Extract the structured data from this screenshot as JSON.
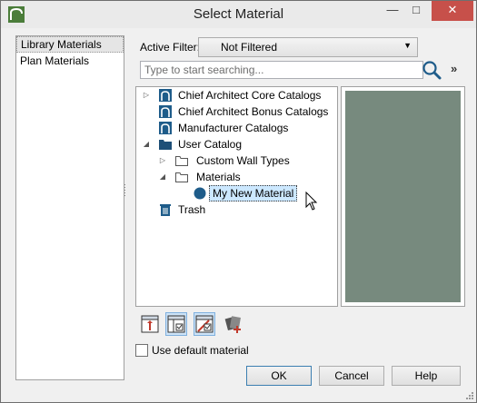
{
  "window": {
    "title": "Select Material",
    "minimize_glyph": "—",
    "maximize_glyph": "□",
    "close_glyph": "✕"
  },
  "left_list": {
    "items": [
      {
        "label": "Library Materials",
        "selected": true
      },
      {
        "label": "Plan Materials",
        "selected": false
      }
    ]
  },
  "filter": {
    "label": "Active Filter:",
    "value": "Not Filtered",
    "arrow": "▼"
  },
  "search": {
    "placeholder": "Type to start searching...",
    "value": "",
    "expand_glyph": "»"
  },
  "tree": {
    "items": [
      {
        "label": "Chief Architect Core Catalogs",
        "expander": "▷",
        "icon": "library-book-icon"
      },
      {
        "label": "Chief Architect Bonus Catalogs",
        "expander": "",
        "icon": "library-book-icon"
      },
      {
        "label": "Manufacturer Catalogs",
        "expander": "",
        "icon": "library-book-icon"
      },
      {
        "label": "User Catalog",
        "expander": "◢",
        "icon": "folder-dark-icon"
      },
      {
        "label": "Custom Wall Types",
        "expander": "▷",
        "icon": "folder-outline-icon"
      },
      {
        "label": "Materials",
        "expander": "◢",
        "icon": "folder-outline-icon"
      },
      {
        "label": "My New Material",
        "expander": "",
        "icon": "material-dot-icon",
        "selected": true
      },
      {
        "label": "Trash",
        "expander": "",
        "icon": "trash-icon"
      }
    ]
  },
  "preview": {
    "color": "#778a7e"
  },
  "toolbar": {
    "buttons": [
      "new-material-icon",
      "show-catalog-icon",
      "show-attributes-icon",
      "add-to-catalog-icon"
    ]
  },
  "options": {
    "use_default_label": "Use default material",
    "use_default_checked": false
  },
  "buttons": {
    "ok": "OK",
    "cancel": "Cancel",
    "help": "Help"
  },
  "colors": {
    "accent": "#1e5c8a",
    "close": "#c7504a",
    "selection": "#cce8ff"
  }
}
